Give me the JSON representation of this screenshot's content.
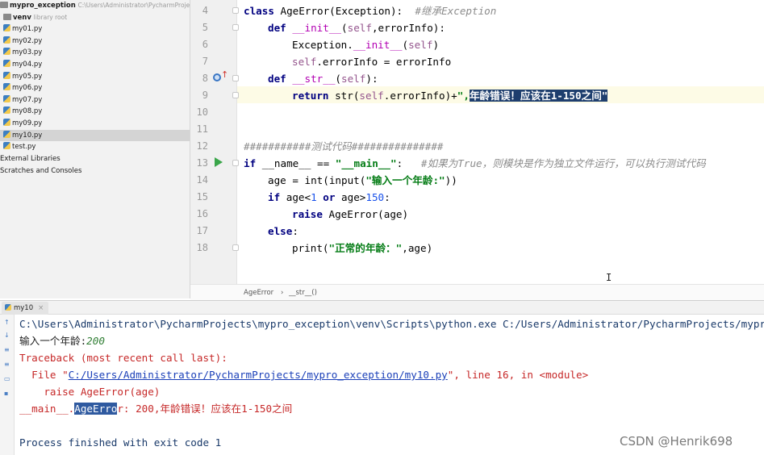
{
  "project_tree": {
    "root_name": "mypro_exception",
    "root_path": "C:\\Users\\Administrator\\PycharmProjects\\mypro_exception",
    "venv_label": "venv",
    "venv_note": "library root",
    "files": [
      "my01.py",
      "my02.py",
      "my03.py",
      "my04.py",
      "my05.py",
      "my06.py",
      "my07.py",
      "my08.py",
      "my09.py",
      "my10.py",
      "test.py"
    ],
    "selected_file": "my10.py",
    "external_libraries": "External Libraries",
    "scratches": "Scratches and Consoles"
  },
  "editor": {
    "line_numbers": [
      "4",
      "5",
      "6",
      "7",
      "8",
      "9",
      "10",
      "11",
      "12",
      "13",
      "14",
      "15",
      "16",
      "17",
      "18"
    ],
    "code": {
      "l4_kw": "class ",
      "l4_name": "AgeError(Exception):",
      "l4_cm": "  #继承Exception",
      "l5_kw": "def ",
      "l5_fn": "__init__",
      "l5_a": "(",
      "l5_self": "self",
      "l5_b": ",errorInfo):",
      "l6_a": "Exception.",
      "l6_fn": "__init__",
      "l6_b": "(",
      "l6_self": "self",
      "l6_c": ")",
      "l7_self": "self",
      "l7_rest": ".errorInfo = errorInfo",
      "l8_kw": "def ",
      "l8_fn": "__str__",
      "l8_a": "(",
      "l8_self": "self",
      "l8_b": "):",
      "l9_kw": "return ",
      "l9_a": "str(",
      "l9_self": "self",
      "l9_b": ".errorInfo)+",
      "l9_st": "\",",
      "l9_sel": "年龄错误！应该在1-150之间\"",
      "l12_cm": "###########测试代码###############",
      "l13_kw": "if ",
      "l13_a": "__name__ == ",
      "l13_st": "\"__main__\"",
      "l13_b": ":",
      "l13_cm": "   #如果为True，则模块是作为独立文件运行，可以执行测试代码",
      "l14_a": "age = int(input(",
      "l14_st": "\"输入一个年龄:\"",
      "l14_b": "))",
      "l15_kw": "if ",
      "l15_a": "age<",
      "l15_n1": "1",
      "l15_kw2": " or ",
      "l15_b": "age>",
      "l15_n2": "150",
      "l15_c": ":",
      "l16_kw": "raise ",
      "l16_a": "AgeError(age)",
      "l17_kw": "else",
      "l17_a": ":",
      "l18_a": "print(",
      "l18_st": "\"正常的年龄：\"",
      "l18_b": ",age)"
    }
  },
  "breadcrumb": {
    "item1": "AgeError",
    "sep": "›",
    "item2": "__str__()"
  },
  "run_panel": {
    "tab_label": "my10",
    "console": {
      "cmd": "C:\\Users\\Administrator\\PycharmProjects\\mypro_exception\\venv\\Scripts\\python.exe C:/Users/Administrator/PycharmProjects/mypro_",
      "prompt": "输入一个年龄:",
      "input_value": "200",
      "traceback": "Traceback (most recent call last):",
      "file_prefix": "  File \"",
      "file_link": "C:/Users/Administrator/PycharmProjects/mypro_exception/my10.py",
      "file_suffix": "\", line 16, in <module>",
      "raise_line": "    raise AgeError(age)",
      "err_prefix": "__main__.",
      "err_sel": "AgeErro",
      "err_rest": "r: 200,年龄错误！应该在1-150之间",
      "finished": "Process finished with exit code 1"
    }
  },
  "watermark": "CSDN @Henrik698"
}
